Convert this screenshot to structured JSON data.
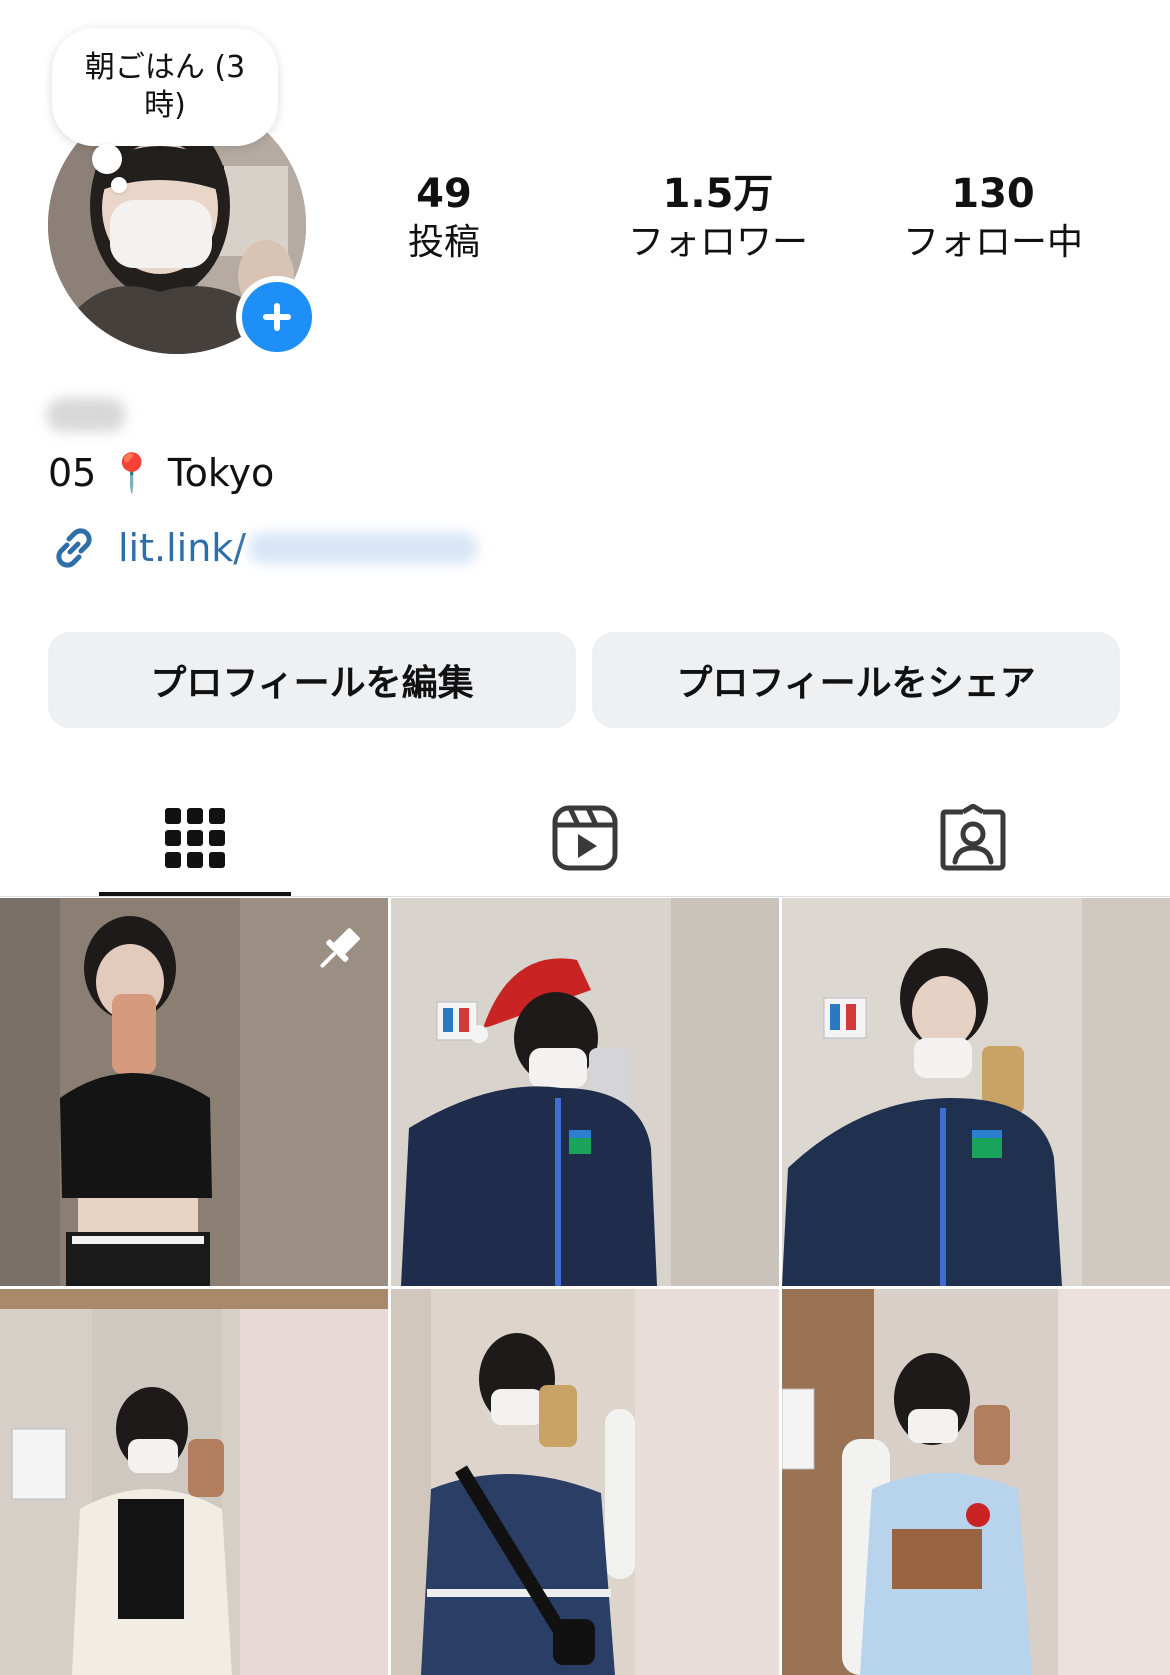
{
  "profile": {
    "note": "朝ごはん (3時)",
    "bio": "05 📍 Tokyo",
    "link_prefix": "lit.link/"
  },
  "stats": [
    {
      "value": "49",
      "label": "投稿"
    },
    {
      "value": "1.5万",
      "label": "フォロワー"
    },
    {
      "value": "130",
      "label": "フォロー中"
    }
  ],
  "buttons": {
    "edit": "プロフィールを編集",
    "share": "プロフィールをシェア"
  },
  "tabs": [
    {
      "name": "posts",
      "icon": "grid-icon",
      "active": true
    },
    {
      "name": "reels",
      "icon": "reels-icon",
      "active": false
    },
    {
      "name": "tagged",
      "icon": "tagged-person-icon",
      "active": false
    }
  ],
  "colors": {
    "accent_blue": "#1d8ff6",
    "link_blue": "#2f6fa8",
    "button_gray": "#eff0f2"
  },
  "grid": {
    "pinned_icon": "pin-icon"
  }
}
